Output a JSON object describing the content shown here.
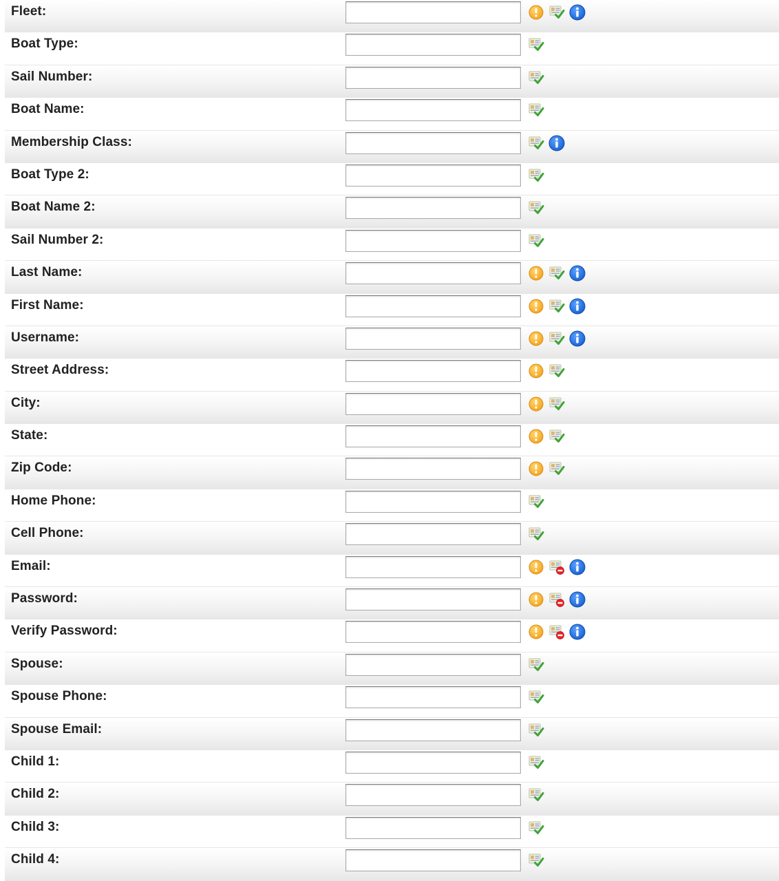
{
  "colors": {
    "required_icon": "#f5a623",
    "info_icon": "#1a64d6",
    "error_badge": "#e8232b",
    "check_green": "#3fa33a"
  },
  "rows": [
    {
      "label": "Fleet:",
      "value": "",
      "icons": [
        "required-icon",
        "editable-icon",
        "info-icon"
      ]
    },
    {
      "label": "Boat Type:",
      "value": "",
      "icons": [
        "editable-icon"
      ]
    },
    {
      "label": "Sail Number:",
      "value": "",
      "icons": [
        "editable-icon"
      ]
    },
    {
      "label": "Boat Name:",
      "value": "",
      "icons": [
        "editable-icon"
      ]
    },
    {
      "label": "Membership Class:",
      "value": "",
      "icons": [
        "editable-icon",
        "info-icon"
      ]
    },
    {
      "label": "Boat Type 2:",
      "value": "",
      "icons": [
        "editable-icon"
      ]
    },
    {
      "label": "Boat Name 2:",
      "value": "",
      "icons": [
        "editable-icon"
      ]
    },
    {
      "label": "Sail Number 2:",
      "value": "",
      "icons": [
        "editable-icon"
      ]
    },
    {
      "label": "Last Name:",
      "value": "",
      "icons": [
        "required-icon",
        "editable-icon",
        "info-icon"
      ]
    },
    {
      "label": "First Name:",
      "value": "",
      "icons": [
        "required-icon",
        "editable-icon",
        "info-icon"
      ]
    },
    {
      "label": "Username:",
      "value": "",
      "icons": [
        "required-icon",
        "editable-icon",
        "info-icon"
      ]
    },
    {
      "label": "Street Address:",
      "value": "",
      "icons": [
        "required-icon",
        "editable-icon"
      ]
    },
    {
      "label": "City:",
      "value": "",
      "icons": [
        "required-icon",
        "editable-icon"
      ]
    },
    {
      "label": "State:",
      "value": "",
      "icons": [
        "required-icon",
        "editable-icon"
      ]
    },
    {
      "label": "Zip Code:",
      "value": "",
      "icons": [
        "required-icon",
        "editable-icon"
      ]
    },
    {
      "label": "Home Phone:",
      "value": "",
      "icons": [
        "editable-icon"
      ]
    },
    {
      "label": "Cell Phone:",
      "value": "",
      "icons": [
        "editable-icon"
      ]
    },
    {
      "label": "Email:",
      "value": "",
      "icons": [
        "required-icon",
        "not-editable-icon",
        "info-icon"
      ]
    },
    {
      "label": "Password:",
      "value": "",
      "icons": [
        "required-icon",
        "not-editable-icon",
        "info-icon"
      ]
    },
    {
      "label": "Verify Password:",
      "value": "",
      "icons": [
        "required-icon",
        "not-editable-icon",
        "info-icon"
      ]
    },
    {
      "label": "Spouse:",
      "value": "",
      "icons": [
        "editable-icon"
      ]
    },
    {
      "label": "Spouse Phone:",
      "value": "",
      "icons": [
        "editable-icon"
      ]
    },
    {
      "label": "Spouse Email:",
      "value": "",
      "icons": [
        "editable-icon"
      ]
    },
    {
      "label": "Child 1:",
      "value": "",
      "icons": [
        "editable-icon"
      ]
    },
    {
      "label": "Child 2:",
      "value": "",
      "icons": [
        "editable-icon"
      ]
    },
    {
      "label": "Child 3:",
      "value": "",
      "icons": [
        "editable-icon"
      ]
    },
    {
      "label": "Child 4:",
      "value": "",
      "icons": [
        "editable-icon"
      ]
    }
  ]
}
